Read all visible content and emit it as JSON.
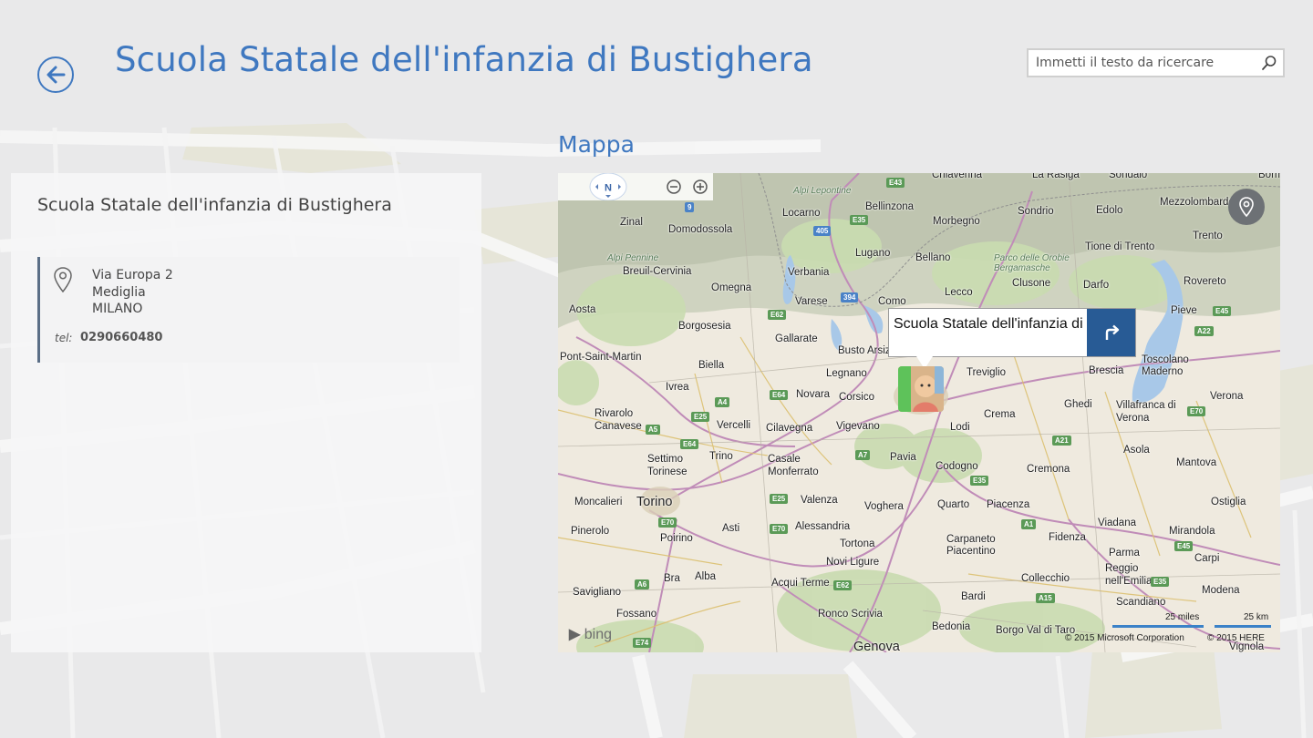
{
  "header": {
    "title": "Scuola Statale dell'infanzia di Bustighera"
  },
  "search": {
    "placeholder": "Immetti il testo da ricercare"
  },
  "details": {
    "name": "Scuola Statale dell'infanzia di Bustighera",
    "address": [
      "Via Europa 2",
      "Mediglia",
      "MILANO"
    ],
    "tel_label": "tel:",
    "tel_value": "0290660480"
  },
  "map": {
    "heading": "Mappa",
    "compass_label": "N",
    "callout_text": "Scuola Statale dell'infanzia di",
    "bing_label": "bing",
    "scale_miles": "25 miles",
    "scale_km": "25 km",
    "copyright_microsoft": "© 2015 Microsoft Corporation",
    "copyright_here": "© 2015 HERE",
    "places": [
      "Chiavenna",
      "La Rasiga",
      "Sondalo",
      "Bormio",
      "Alpi Lepontine",
      "Locarno",
      "Bellinzona",
      "Sondrio",
      "Edolo",
      "Mezzolombardo",
      "Zinal",
      "Domodossola",
      "Morbegno",
      "Tione di Trento",
      "Trento",
      "Alpi Pennine",
      "Breuil-Cervinia",
      "Lugano",
      "Bellano",
      "Parco delle Orobie Bergamasche",
      "Omegna",
      "Verbania",
      "Lecco",
      "Clusone",
      "Darfo",
      "Rovereto",
      "Varese",
      "Como",
      "Aosta",
      "Borgosesia",
      "Gallarate",
      "Busto Arsizio",
      "Pieve",
      "Biella",
      "Legnano",
      "Treviglio",
      "Brescia",
      "Toscolano Maderno",
      "Pont-Saint-Martin",
      "Ivrea",
      "Novara",
      "Corsico",
      "Verona",
      "Rivarolo Canavese",
      "Vercelli",
      "Cilavegna",
      "Vigevano",
      "Lodi",
      "Crema",
      "Ghedi",
      "Villafranca di Verona",
      "Settimo Torinese",
      "Trino",
      "Pavia",
      "Asola",
      "Casale Monferrato",
      "Codogno",
      "Cremona",
      "Mantova",
      "Torino",
      "Moncalieri",
      "Valenza",
      "Voghera",
      "Quarto",
      "Piacenza",
      "Ostiglia",
      "Pinerolo",
      "Asti",
      "Alessandria",
      "Tortona",
      "Carpaneto Piacentino",
      "Viadana",
      "Mirandola",
      "Poirino",
      "Fidenza",
      "Parma",
      "Novi Ligure",
      "Carpi",
      "Reggio nell'Emilia",
      "Savigliano",
      "Bra",
      "Alba",
      "Acqui Terme",
      "Collecchio",
      "Modena",
      "Scandiano",
      "Fossano",
      "Ronco Scrivia",
      "Bardi",
      "Bedonia",
      "Borgo Val di Taro",
      "Genova",
      "Vignola"
    ]
  },
  "colors": {
    "accent": "#3f78c0",
    "directions_button": "#285b95",
    "locate_button": "#6d7175"
  },
  "icons": {
    "back": "back-arrow-icon",
    "search": "search-icon",
    "pin": "location-pin-icon",
    "locate": "locate-me-icon",
    "directions": "directions-arrow-icon",
    "zoom_in": "zoom-in-icon",
    "zoom_out": "zoom-out-icon"
  }
}
